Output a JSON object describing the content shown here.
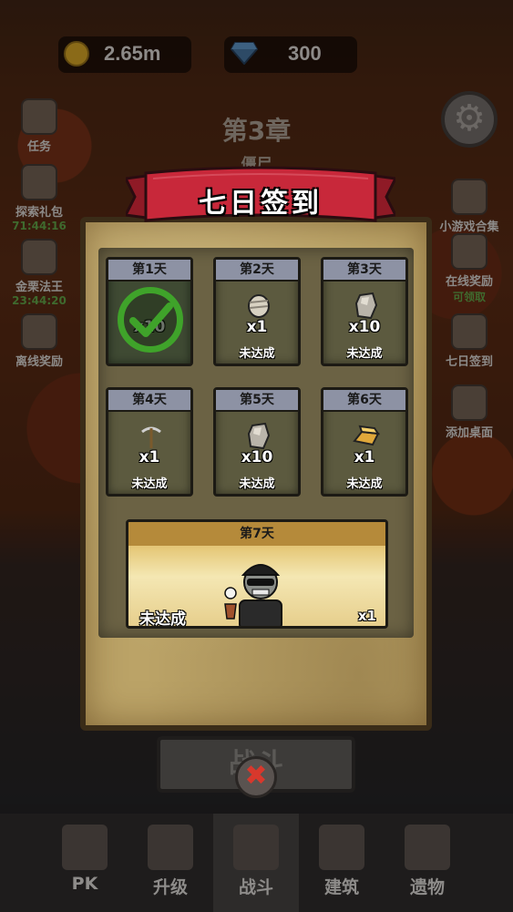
{
  "top_bar": {
    "gold": "2.65m",
    "gems": "300"
  },
  "chapter": {
    "title": "第3章",
    "subtitle": "僵尸"
  },
  "side_left": [
    {
      "label": "任务",
      "timer": ""
    },
    {
      "label": "探索礼包",
      "timer": "71:44:16"
    },
    {
      "label": "金栗法王",
      "timer": "23:44:20"
    },
    {
      "label": "离线奖励",
      "timer": ""
    }
  ],
  "side_right": [
    {
      "label": "小游戏合集",
      "timer": ""
    },
    {
      "label": "在线奖励",
      "timer": "可领取"
    },
    {
      "label": "七日签到",
      "timer": ""
    },
    {
      "label": "添加桌面",
      "timer": ""
    }
  ],
  "dialog": {
    "title": "七日签到",
    "days": [
      {
        "day": "第1天",
        "qty": "x10",
        "status": "",
        "claimed": true,
        "icon": "stone-icon"
      },
      {
        "day": "第2天",
        "qty": "x1",
        "status": "未达成",
        "claimed": false,
        "icon": "mummy-item-icon"
      },
      {
        "day": "第3天",
        "qty": "x10",
        "status": "未达成",
        "claimed": false,
        "icon": "stone-icon"
      },
      {
        "day": "第4天",
        "qty": "x1",
        "status": "未达成",
        "claimed": false,
        "icon": "pickaxe-icon"
      },
      {
        "day": "第5天",
        "qty": "x10",
        "status": "未达成",
        "claimed": false,
        "icon": "stone-icon"
      },
      {
        "day": "第6天",
        "qty": "x1",
        "status": "未达成",
        "claimed": false,
        "icon": "gold-bar-icon"
      }
    ],
    "day7": {
      "day": "第7天",
      "status": "未达成",
      "qty": "x1",
      "icon": "zombie-character-icon"
    }
  },
  "battle_button": "战斗",
  "bottom_nav": [
    {
      "label": "PK",
      "icon": "pk-shield-icon"
    },
    {
      "label": "升级",
      "icon": "book-icon"
    },
    {
      "label": "战斗",
      "icon": "crossed-swords-icon"
    },
    {
      "label": "建筑",
      "icon": "shop-icon"
    },
    {
      "label": "遗物",
      "icon": "cards-icon"
    }
  ],
  "colors": {
    "check_green": "#3fa32a",
    "banner_red": "#c8283a",
    "close_red": "#d8382c"
  }
}
